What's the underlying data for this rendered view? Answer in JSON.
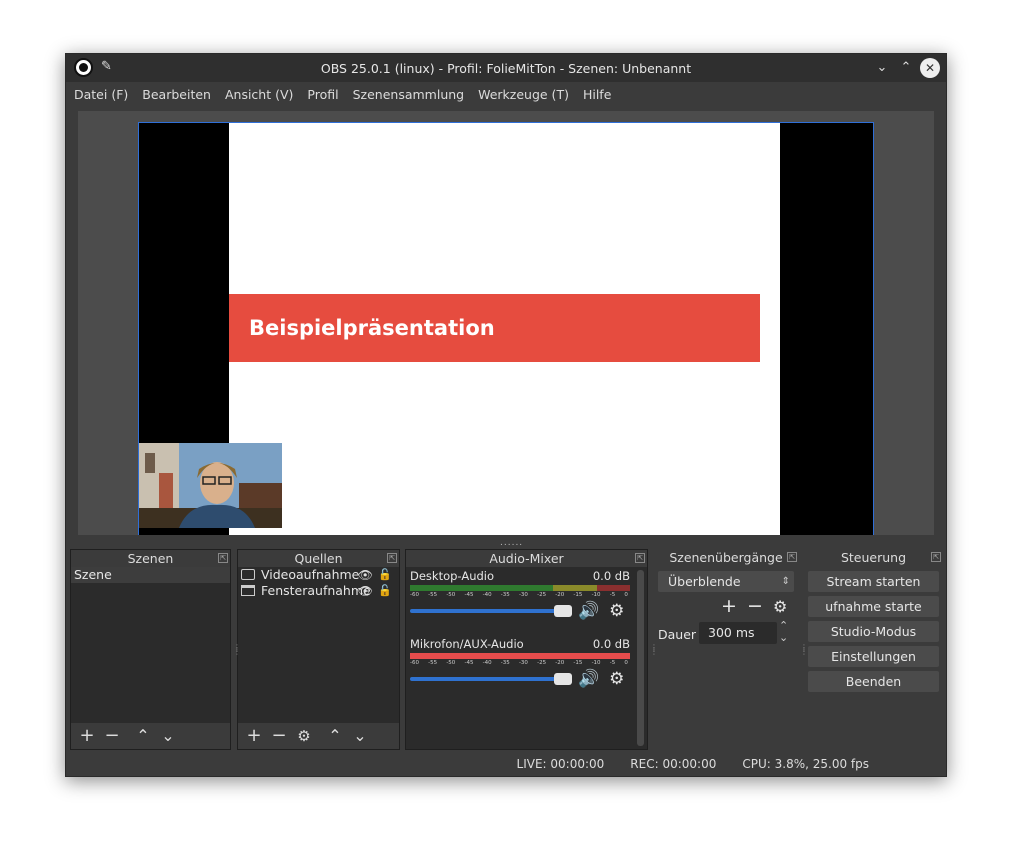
{
  "window": {
    "title": "OBS 25.0.1 (linux) - Profil: FolieMitTon - Szenen: Unbenannt",
    "minimize_icon": "chevron-down-icon",
    "maximize_icon": "chevron-up-icon",
    "close_icon": "close-icon"
  },
  "menu": [
    "Datei (F)",
    "Bearbeiten",
    "Ansicht (V)",
    "Profil",
    "Szenensammlung",
    "Werkzeuge (T)",
    "Hilfe"
  ],
  "preview": {
    "slide_title": "Beispielpräsentation"
  },
  "scenes": {
    "title": "Szenen",
    "items": [
      "Szene"
    ]
  },
  "sources": {
    "title": "Quellen",
    "items": [
      "Videoaufnahme",
      "Fensteraufnahme"
    ]
  },
  "mixer": {
    "title": "Audio-Mixer",
    "channels": [
      {
        "name": "Desktop-Audio",
        "level": "0.0 dB",
        "volume": 1.0
      },
      {
        "name": "Mikrofon/AUX-Audio",
        "level": "0.0 dB",
        "volume": 1.0
      }
    ],
    "scale": [
      "-60",
      "-55",
      "-50",
      "-45",
      "-40",
      "-35",
      "-30",
      "-25",
      "-20",
      "-15",
      "-10",
      "-5",
      "0"
    ]
  },
  "transitions": {
    "title": "Szenenübergänge",
    "selected": "Überblende",
    "duration_label": "Dauer",
    "duration_value": "300 ms"
  },
  "controls": {
    "title": "Steuerung",
    "buttons": [
      "Stream starten",
      "ufnahme starte",
      "Studio-Modus",
      "Einstellungen",
      "Beenden"
    ]
  },
  "status": {
    "live": "LIVE: 00:00:00",
    "rec": "REC: 00:00:00",
    "cpu": "CPU: 3.8%, 25.00 fps"
  }
}
